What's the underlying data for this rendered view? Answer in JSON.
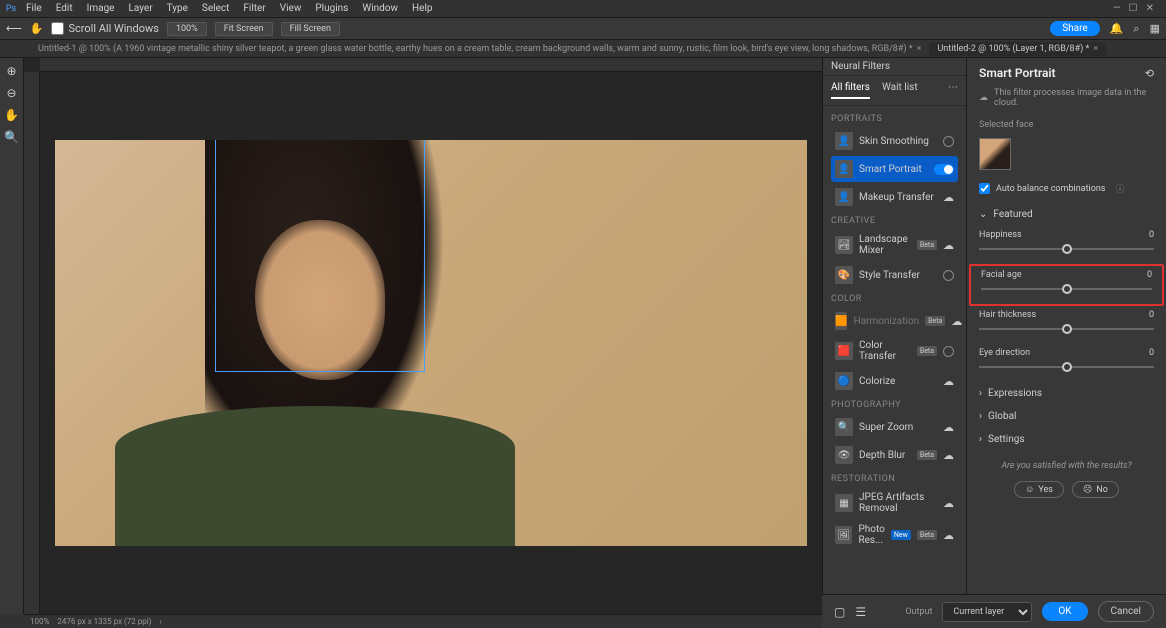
{
  "menu": [
    "File",
    "Edit",
    "Image",
    "Layer",
    "Type",
    "Select",
    "Filter",
    "View",
    "Plugins",
    "Window",
    "Help"
  ],
  "toolbar": {
    "scroll_label": "Scroll All Windows",
    "zoom": "100%",
    "fit": "Fit Screen",
    "fill": "Fill Screen",
    "share": "Share"
  },
  "tabs": [
    {
      "label": "Untitled-1 @ 100% (A 1960 vintage metallic shiny silver teapot, a green glass water bottle, earthy hues on a cream table, cream background walls, warm and sunny, rustic, film look, bird's eye view, long shadows, RGB/8#) *",
      "active": false
    },
    {
      "label": "Untitled-2 @ 100% (Layer 1, RGB/8#) *",
      "active": true
    }
  ],
  "neural": {
    "header": "Neural Filters",
    "tab_all": "All filters",
    "tab_wait": "Wait list",
    "sections": {
      "portraits": "PORTRAITS",
      "creative": "CREATIVE",
      "color": "COLOR",
      "photography": "PHOTOGRAPHY",
      "restoration": "RESTORATION"
    },
    "items": {
      "skin": "Skin Smoothing",
      "smart": "Smart Portrait",
      "makeup": "Makeup Transfer",
      "landscape": "Landscape Mixer",
      "style": "Style Transfer",
      "harmon": "Harmonization",
      "colorxfer": "Color Transfer",
      "colorize": "Colorize",
      "superzoom": "Super Zoom",
      "depth": "Depth Blur",
      "jpeg": "JPEG Artifacts Removal",
      "photores": "Photo Res..."
    },
    "beta": "Beta",
    "new": "New"
  },
  "smart": {
    "title": "Smart Portrait",
    "note": "This filter processes image data in the cloud.",
    "selface": "Selected face",
    "autobal": "Auto balance combinations",
    "featured": "Featured",
    "happiness": {
      "label": "Happiness",
      "value": "0"
    },
    "facial_age": {
      "label": "Facial age",
      "value": "0"
    },
    "hair": {
      "label": "Hair thickness",
      "value": "0"
    },
    "eye": {
      "label": "Eye direction",
      "value": "0"
    },
    "expressions": "Expressions",
    "global": "Global",
    "settings": "Settings",
    "satisfied": "Are you satisfied with the results?",
    "yes": "Yes",
    "no": "No"
  },
  "bottom": {
    "output": "Output",
    "current": "Current layer",
    "ok": "OK",
    "cancel": "Cancel"
  },
  "status": {
    "zoom": "100%",
    "dims": "2476 px x 1335 px (72 ppi)"
  }
}
